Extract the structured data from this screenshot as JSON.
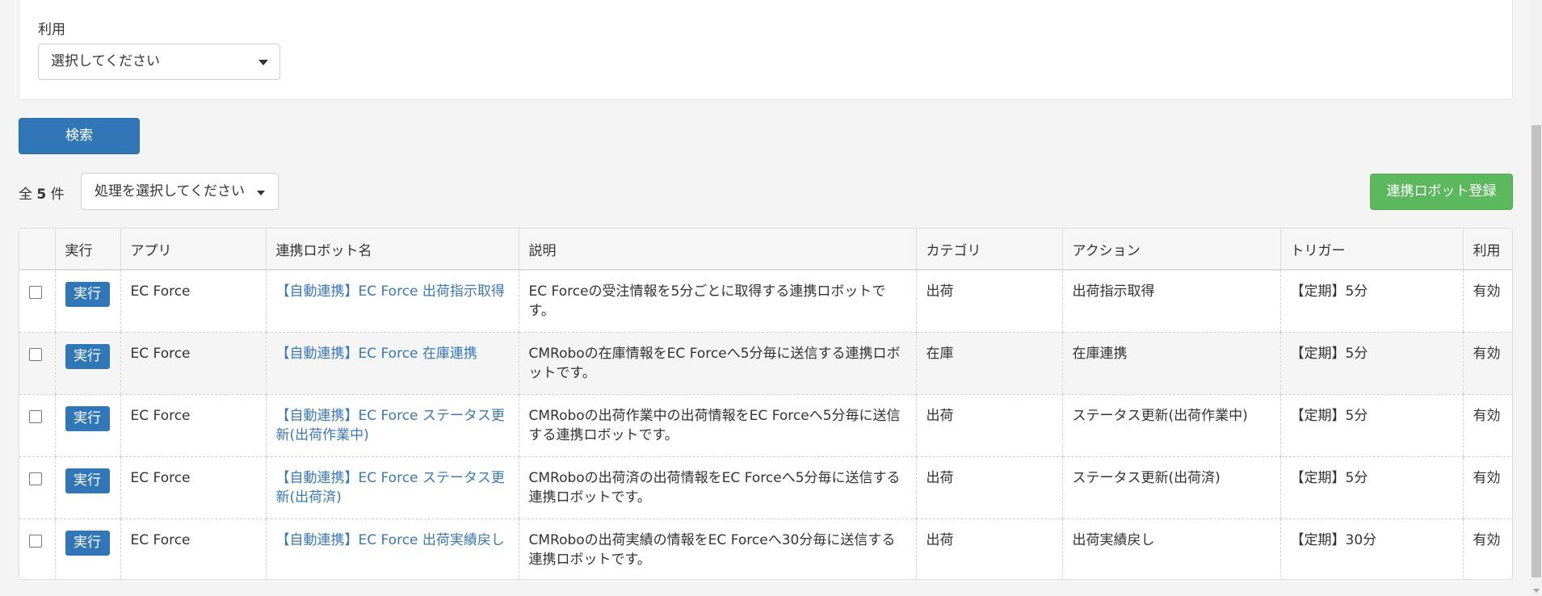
{
  "filter": {
    "label": "利用",
    "select_value": "選択してください"
  },
  "search_button": "検索",
  "toolbar": {
    "count_prefix": "全",
    "count": "5",
    "count_suffix": "件",
    "bulk_action_placeholder": "処理を選択してください",
    "register_button": "連携ロボット登録"
  },
  "table": {
    "headers": [
      "実行",
      "アプリ",
      "連携ロボット名",
      "説明",
      "カテゴリ",
      "アクション",
      "トリガー",
      "利用"
    ],
    "run_label": "実行",
    "rows": [
      {
        "app": "EC Force",
        "name": "【自動連携】EC Force 出荷指示取得",
        "description": "EC Forceの受注情報を5分ごとに取得する連携ロボットです。",
        "category": "出荷",
        "action": "出荷指示取得",
        "trigger": "【定期】5分",
        "status": "有効"
      },
      {
        "app": "EC Force",
        "name": "【自動連携】EC Force 在庫連携",
        "description": "CMRoboの在庫情報をEC Forceへ5分毎に送信する連携ロボットです。",
        "category": "在庫",
        "action": "在庫連携",
        "trigger": "【定期】5分",
        "status": "有効"
      },
      {
        "app": "EC Force",
        "name": "【自動連携】EC Force ステータス更新(出荷作業中)",
        "description": "CMRoboの出荷作業中の出荷情報をEC Forceへ5分毎に送信する連携ロボットです。",
        "category": "出荷",
        "action": "ステータス更新(出荷作業中)",
        "trigger": "【定期】5分",
        "status": "有効"
      },
      {
        "app": "EC Force",
        "name": "【自動連携】EC Force ステータス更新(出荷済)",
        "description": "CMRoboの出荷済の出荷情報をEC Forceへ5分毎に送信する連携ロボットです。",
        "category": "出荷",
        "action": "ステータス更新(出荷済)",
        "trigger": "【定期】5分",
        "status": "有効"
      },
      {
        "app": "EC Force",
        "name": "【自動連携】EC Force 出荷実績戻し",
        "description": "CMRoboの出荷実績の情報をEC Forceへ30分毎に送信する連携ロボットです。",
        "category": "出荷",
        "action": "出荷実績戻し",
        "trigger": "【定期】30分",
        "status": "有効"
      }
    ]
  }
}
